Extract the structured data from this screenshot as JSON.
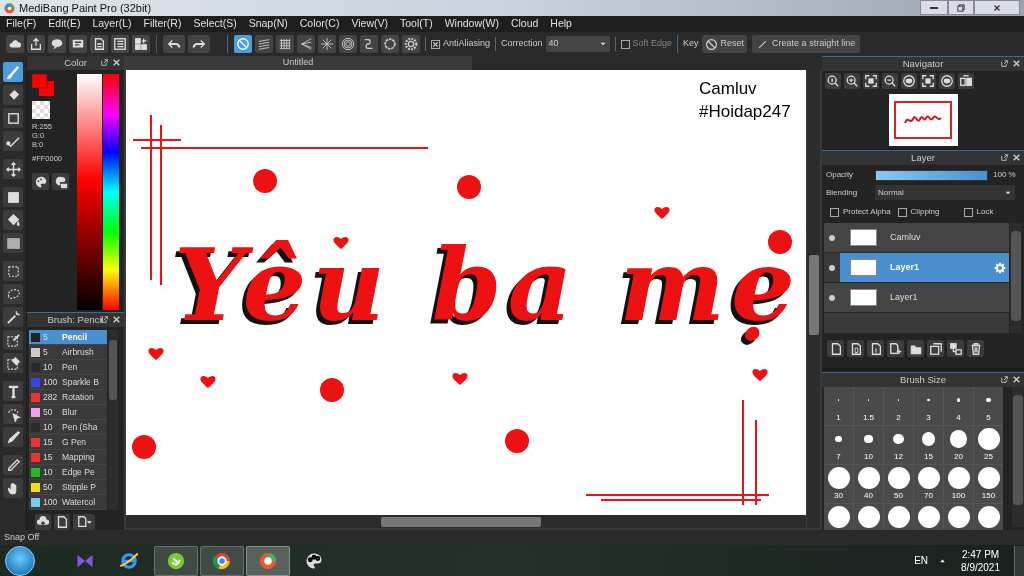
{
  "window": {
    "title": "MediBang Paint Pro (32bit)"
  },
  "menu": [
    "File(F)",
    "Edit(E)",
    "Layer(L)",
    "Filter(R)",
    "Select(S)",
    "Snap(N)",
    "Color(C)",
    "View(V)",
    "Tool(T)",
    "Window(W)",
    "Cloud",
    "Help"
  ],
  "toolbar": {
    "snap_buttons": [
      {
        "selected": true
      },
      {
        "selected": false
      },
      {
        "selected": false
      },
      {
        "selected": false
      },
      {
        "selected": false
      },
      {
        "selected": false
      },
      {
        "selected": false
      },
      {
        "selected": false
      },
      {
        "selected": false
      }
    ],
    "antialiasing": {
      "label": "AntiAliasing",
      "checked": true
    },
    "correction": {
      "label": "Correction",
      "value": "40"
    },
    "soft_edge": {
      "label": "Soft Edge",
      "checked": false
    },
    "key_label": "Key",
    "reset_button": "Reset",
    "straight_line_button": "Create a straight line"
  },
  "tools": [
    {
      "selected": true
    },
    {
      "selected": false
    },
    {
      "selected": false
    },
    {
      "selected": false
    },
    {
      "selected": false
    },
    {
      "selected": false
    },
    {
      "selected": false
    },
    {
      "selected": false
    },
    {
      "selected": false
    },
    {
      "selected": false
    },
    {
      "selected": false
    },
    {
      "selected": false
    },
    {
      "selected": false
    },
    {
      "selected": false
    },
    {
      "selected": false
    },
    {
      "selected": false
    },
    {
      "selected": false
    },
    {
      "selected": false
    }
  ],
  "color_panel": {
    "title": "Color",
    "r": "R:255",
    "g": "G:0",
    "b": "B:0",
    "hex": "#FF0000"
  },
  "brush_panel": {
    "title": "Brush: Pencil",
    "brushes": [
      {
        "size": "5",
        "name": "Pencil",
        "color": "#222222",
        "selected": true
      },
      {
        "size": "5",
        "name": "Airbrush",
        "color": "#cccccc",
        "selected": false
      },
      {
        "size": "10",
        "name": "Pen",
        "color": "#2a2a2a",
        "selected": false
      },
      {
        "size": "100",
        "name": "Sparkle B",
        "color": "#3344ee",
        "selected": false
      },
      {
        "size": "282",
        "name": "Rotation",
        "color": "#ee3333",
        "selected": false
      },
      {
        "size": "50",
        "name": "Blur",
        "color": "#f0a0f0",
        "selected": false
      },
      {
        "size": "10",
        "name": "Pen (Sha",
        "color": "#2a2a2a",
        "selected": false
      },
      {
        "size": "15",
        "name": "G Pen",
        "color": "#ee3333",
        "selected": false
      },
      {
        "size": "15",
        "name": "Mapping",
        "color": "#ee3333",
        "selected": false
      },
      {
        "size": "10",
        "name": "Edge Pe",
        "color": "#22bb22",
        "selected": false
      },
      {
        "size": "50",
        "name": "Stipple P",
        "color": "#eedd11",
        "selected": false
      },
      {
        "size": "100",
        "name": "Watercol",
        "color": "#77ccee",
        "selected": false
      }
    ]
  },
  "document": {
    "tab": "Untitled",
    "texts": [
      "Camluv",
      "#Hoidap247"
    ],
    "lettering": "Yêu ba mẹ"
  },
  "navigator": {
    "title": "Navigator"
  },
  "layer_panel": {
    "title": "Layer",
    "opacity_label": "Opacity",
    "opacity": {
      "level": 1.0
    },
    "opacity_value": "100 %",
    "blending_label": "Blending",
    "blending": "Normal",
    "options": [
      {
        "label": "Protect Alpha",
        "checked": false
      },
      {
        "label": "Clipping",
        "checked": false
      },
      {
        "label": "Lock",
        "checked": false
      }
    ],
    "layers": [
      {
        "name": "Camluv",
        "selected": false
      },
      {
        "name": "Layer1",
        "selected": true
      },
      {
        "name": "Layer1",
        "selected": false
      }
    ]
  },
  "brush_size_panel": {
    "title": "Brush Size",
    "sizes": [
      {
        "kind": "labeled",
        "label": "1"
      },
      {
        "kind": "labeled",
        "label": "1.5"
      },
      {
        "kind": "labeled",
        "label": "2"
      },
      {
        "kind": "labeled",
        "label": "3"
      },
      {
        "kind": "labeled",
        "label": "4"
      },
      {
        "kind": "labeled",
        "label": "5"
      },
      {
        "kind": "labeled",
        "label": "7"
      },
      {
        "kind": "labeled",
        "label": "10"
      },
      {
        "kind": "labeled",
        "label": "12"
      },
      {
        "kind": "labeled",
        "label": "15"
      },
      {
        "kind": "labeled",
        "label": "20"
      },
      {
        "kind": "labeled",
        "label": "25"
      },
      {
        "kind": "labeled",
        "label": "30"
      },
      {
        "kind": "labeled",
        "label": "40"
      },
      {
        "kind": "labeled",
        "label": "50"
      },
      {
        "kind": "labeled",
        "label": "70"
      },
      {
        "kind": "labeled",
        "label": "100"
      },
      {
        "kind": "labeled",
        "label": "150"
      },
      {
        "kind": "cut"
      },
      {
        "kind": "cut"
      },
      {
        "kind": "cut"
      },
      {
        "kind": "cut"
      },
      {
        "kind": "cut"
      },
      {
        "kind": "cut"
      }
    ]
  },
  "status_bar": "Snap Off",
  "taskbar": {
    "language": "EN",
    "time": "2:47 PM",
    "date": "8/9/2021"
  }
}
